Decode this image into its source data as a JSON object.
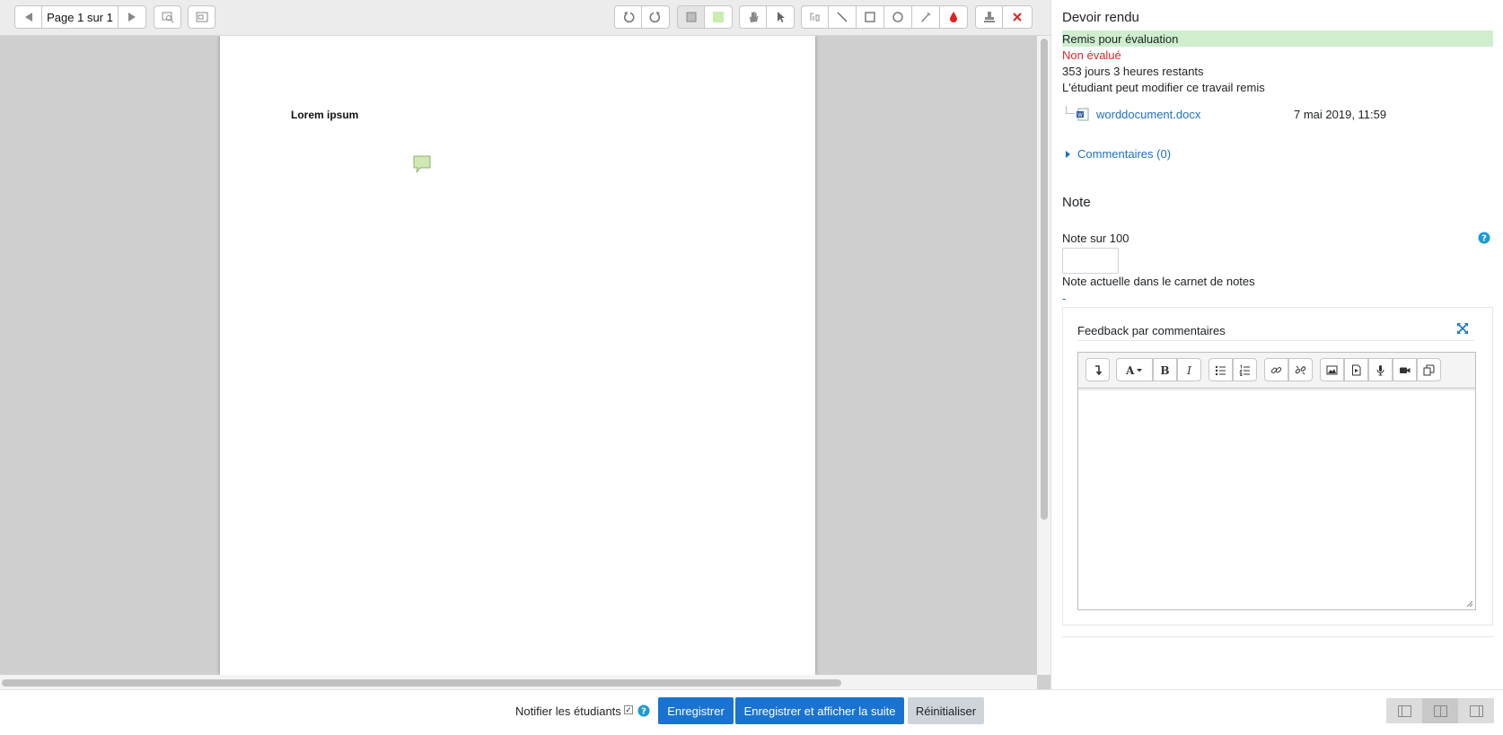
{
  "toolbar": {
    "prev_page": "previous-page",
    "page_label": "Page 1 sur 1",
    "next_page": "next-page"
  },
  "document": {
    "text": "Lorem ipsum"
  },
  "panel": {
    "title": "Devoir rendu",
    "status_submitted": "Remis pour évaluation",
    "status_graded": "Non évalué",
    "time_remaining": "353 jours 3 heures restants",
    "can_edit": "L'étudiant peut modifier ce travail remis",
    "file_name": "worddocument.docx",
    "file_date": "7 mai 2019, 11:59",
    "comments_link": "Commentaires (0)",
    "grade_title": "Note",
    "grade_label": "Note sur 100",
    "grade_value": "",
    "gradebook_label": "Note actuelle dans le carnet de notes",
    "gradebook_value": "-",
    "feedback_label": "Feedback par commentaires"
  },
  "footer": {
    "notify_label": "Notifier les étudiants",
    "notify_checked": true,
    "save": "Enregistrer",
    "save_next": "Enregistrer et afficher la suite",
    "reset": "Réinitialiser"
  },
  "colors": {
    "accent": "#1a73d1",
    "link": "#1f6fbf",
    "status_ok_bg": "#cfeece",
    "status_error": "#d9262c",
    "highlight_swatch": "#c8eeb0",
    "stamp_red": "#e02020"
  }
}
